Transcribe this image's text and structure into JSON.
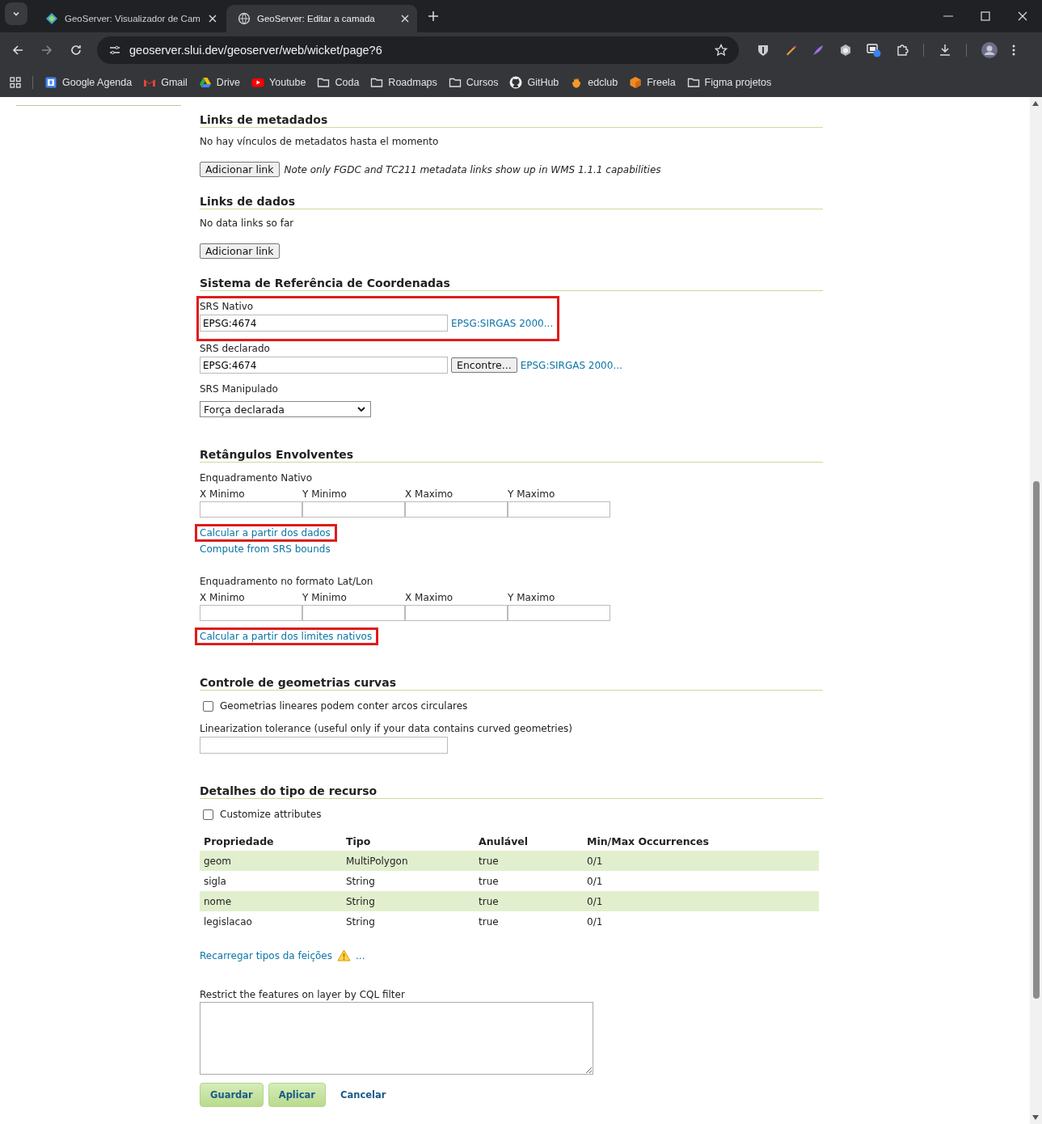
{
  "browser": {
    "tabs": [
      {
        "title": "GeoServer: Visualizador de Cam",
        "selected": false
      },
      {
        "title": "GeoServer: Editar a camada",
        "selected": true
      }
    ],
    "url": "geoserver.slui.dev/geoserver/web/wicket/page?6",
    "bookmarks": [
      {
        "label": "Google Agenda",
        "kind": "calendar"
      },
      {
        "label": "Gmail",
        "kind": "mail"
      },
      {
        "label": "Drive",
        "kind": "drive"
      },
      {
        "label": "Youtube",
        "kind": "video"
      },
      {
        "label": "Coda",
        "kind": "folder"
      },
      {
        "label": "Roadmaps",
        "kind": "folder"
      },
      {
        "label": "Cursos",
        "kind": "folder"
      },
      {
        "label": "GitHub",
        "kind": "github"
      },
      {
        "label": "edclub",
        "kind": "hand"
      },
      {
        "label": "Freela",
        "kind": "cube"
      },
      {
        "label": "Figma projetos",
        "kind": "folder"
      }
    ]
  },
  "metadata_links": {
    "heading": "Links de metadados",
    "empty_text": "No hay vínculos de metadatos hasta el momento",
    "add_button": "Adicionar link",
    "note": "Note only FGDC and TC211 metadata links show up in WMS 1.1.1 capabilities"
  },
  "data_links": {
    "heading": "Links de dados",
    "empty_text": "No data links so far",
    "add_button": "Adicionar link"
  },
  "crs": {
    "heading": "Sistema de Referência de Coordenadas",
    "native_label": "SRS Nativo",
    "native_value": "EPSG:4674",
    "native_link": "EPSG:SIRGAS 2000...",
    "native_highlighted": true,
    "declared_label": "SRS declarado",
    "declared_value": "EPSG:4674",
    "find_button": "Encontre...",
    "declared_link": "EPSG:SIRGAS 2000...",
    "handling_label": "SRS Manipulado",
    "handling_value": "Força declarada"
  },
  "bounding_boxes": {
    "heading": "Retângulos Envolventes",
    "groups": [
      {
        "label": "Enquadramento Nativo",
        "columns": [
          "X Minimo",
          "Y Minimo",
          "X Maximo",
          "Y Maximo"
        ],
        "links": [
          {
            "label": "Calcular a partir dos dados",
            "highlighted": true
          },
          {
            "label": "Compute from SRS bounds",
            "highlighted": false
          }
        ]
      },
      {
        "label": "Enquadramento no formato Lat/Lon",
        "columns": [
          "X Minimo",
          "Y Minimo",
          "X Maximo",
          "Y Maximo"
        ],
        "links": [
          {
            "label": "Calcular a partir dos limites nativos",
            "highlighted": true
          }
        ]
      }
    ]
  },
  "curves": {
    "heading": "Controle de geometrias curvas",
    "checkbox": {
      "label": "Geometrias lineares podem conter arcos circulares",
      "checked": false
    },
    "tolerance_label": "Linearization tolerance (useful only if your data contains curved geometries)"
  },
  "feature_type": {
    "heading": "Detalhes do tipo de recurso",
    "customize": {
      "label": "Customize attributes",
      "checked": false
    },
    "table": {
      "columns": [
        "Propriedade",
        "Tipo",
        "Anulável",
        "Min/Max Occurrences"
      ],
      "rows": [
        [
          "geom",
          "MultiPolygon",
          "true",
          "0/1"
        ],
        [
          "sigla",
          "String",
          "true",
          "0/1"
        ],
        [
          "nome",
          "String",
          "true",
          "0/1"
        ],
        [
          "legislacao",
          "String",
          "true",
          "0/1"
        ]
      ]
    },
    "reload_link": "Recarregar tipos da feições",
    "reload_more": "...",
    "cql_label": "Restrict the features on layer by CQL filter"
  },
  "actions": [
    {
      "label": "Guardar",
      "kind": "primary"
    },
    {
      "label": "Aplicar",
      "kind": "primary"
    },
    {
      "label": "Cancelar",
      "kind": "link"
    }
  ]
}
